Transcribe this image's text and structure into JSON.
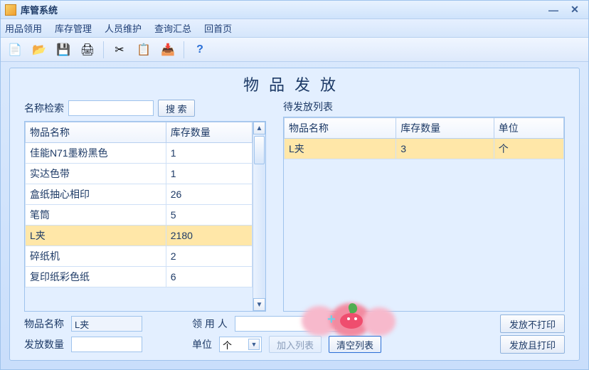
{
  "window": {
    "title": "库管系统"
  },
  "menu": {
    "items": [
      "用品领用",
      "库存管理",
      "人员维护",
      "查询汇总",
      "回首页"
    ]
  },
  "toolbar": {
    "icons": [
      "new-icon",
      "open-icon",
      "save-icon",
      "print-icon",
      "cut-icon",
      "copy-icon",
      "paste-icon",
      "help-icon"
    ]
  },
  "page": {
    "heading": "物品发放",
    "search": {
      "label": "名称检索",
      "value": "",
      "button": "搜 索"
    },
    "grid_left": {
      "columns": [
        "物品名称",
        "库存数量"
      ],
      "rows": [
        {
          "name": "佳能N71墨粉黑色",
          "qty": "1"
        },
        {
          "name": "实达色带",
          "qty": "1"
        },
        {
          "name": "盒纸抽心相印",
          "qty": "26"
        },
        {
          "name": "笔筒",
          "qty": "5"
        },
        {
          "name": "L夹",
          "qty": "2180",
          "selected": true
        },
        {
          "name": "碎纸机",
          "qty": "2"
        },
        {
          "name": "复印纸彩色纸",
          "qty": "6"
        }
      ]
    },
    "pending": {
      "label": "待发放列表",
      "columns": [
        "物品名称",
        "库存数量",
        "单位"
      ],
      "rows": [
        {
          "name": "L夹",
          "qty": "3",
          "unit": "个",
          "selected": true
        }
      ]
    },
    "form": {
      "name_label": "物品名称",
      "name_value": "L夹",
      "user_label": "领 用 人",
      "user_value": "",
      "qty_label": "发放数量",
      "qty_value": "",
      "unit_label": "单位",
      "unit_value": "个",
      "add_btn": "加入列表",
      "clear_btn": "清空列表",
      "issue_noprint": "发放不打印",
      "issue_print": "发放且打印"
    }
  }
}
